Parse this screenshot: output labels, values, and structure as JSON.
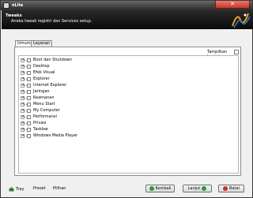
{
  "window": {
    "title": "nLite"
  },
  "header": {
    "title": "Tweaks",
    "description": "Aneka tweak registri dan Services setup."
  },
  "tabs": [
    {
      "label": "Umum",
      "active": true
    },
    {
      "label": "Layanan",
      "active": false
    }
  ],
  "advanced": {
    "label": "Tampilkan Lanjutan",
    "checked": false
  },
  "tree": {
    "items": [
      {
        "label": "Boot dan Shutdown"
      },
      {
        "label": "Desktop"
      },
      {
        "label": "Efek Visual"
      },
      {
        "label": "Explorer"
      },
      {
        "label": "Internet Explorer"
      },
      {
        "label": "Jaringan"
      },
      {
        "label": "Keamanan"
      },
      {
        "label": "Menu Start"
      },
      {
        "label": "My Computer"
      },
      {
        "label": "Performansi"
      },
      {
        "label": "Privasi"
      },
      {
        "label": "Taskbar"
      },
      {
        "label": "Windows Media Player"
      }
    ]
  },
  "bottom": {
    "tray": "Tray",
    "preset": "Preset",
    "pilihan": "Pilihan",
    "back": "Kembali",
    "next": "Lanjut",
    "cancel": "Batal"
  },
  "colors": {
    "header_bg": "#111111",
    "close_btn": "#c7382a",
    "back_icon": "#2e9b2e",
    "cancel_icon": "#d12b2b"
  }
}
